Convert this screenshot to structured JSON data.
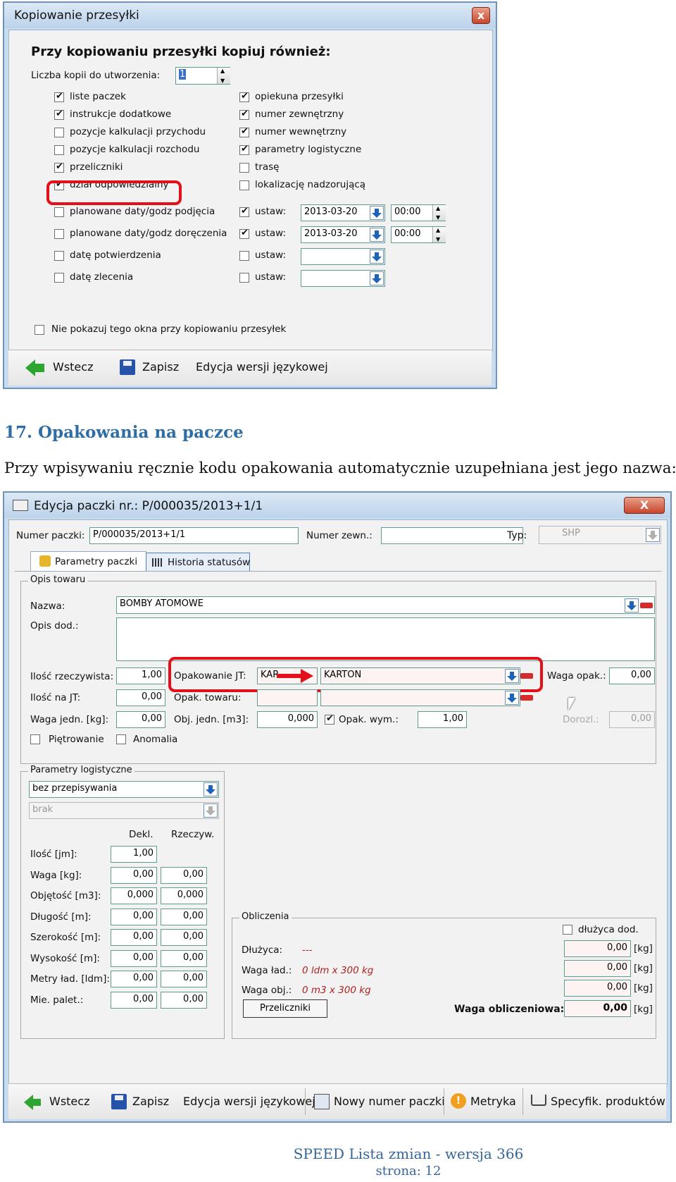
{
  "dialog1": {
    "title": "Kopiowanie przesyłki",
    "close": "x",
    "heading": "Przy kopiowaniu przesyłki kopiuj również:",
    "copies_label": "Liczba kopii do utworzenia:",
    "copies_value": "1",
    "left_checks": [
      {
        "label": "liste paczek",
        "checked": true
      },
      {
        "label": "instrukcje dodatkowe",
        "checked": true
      },
      {
        "label": "pozycje kalkulacji przychodu",
        "checked": false
      },
      {
        "label": "pozycje kalkulacji rozchodu",
        "checked": false
      },
      {
        "label": "przeliczniki",
        "checked": true
      },
      {
        "label": "dział odpowiedzialny",
        "checked": true
      }
    ],
    "right_checks": [
      {
        "label": "opiekuna przesyłki",
        "checked": true
      },
      {
        "label": "numer zewnętrzny",
        "checked": true
      },
      {
        "label": "numer wewnętrzny",
        "checked": true
      },
      {
        "label": "parametry logistyczne",
        "checked": true
      },
      {
        "label": "trasę",
        "checked": false
      },
      {
        "label": "lokalizację nadzorującą",
        "checked": false
      }
    ],
    "date_rows": [
      {
        "label": "planowane daty/godz podjęcia",
        "set_label": "ustaw:",
        "set_checked": true,
        "date": "2013-03-20",
        "time": "00:00"
      },
      {
        "label": "planowane daty/godz doręczenia",
        "set_label": "ustaw:",
        "set_checked": true,
        "date": "2013-03-20",
        "time": "00:00"
      },
      {
        "label": "datę potwierdzenia",
        "set_label": "ustaw:",
        "set_checked": false,
        "date": "",
        "time": ""
      },
      {
        "label": "datę zlecenia",
        "set_label": "ustaw:",
        "set_checked": false,
        "date": "",
        "time": ""
      }
    ],
    "dont_show": "Nie pokazuj tego okna przy kopiowaniu przesyłek",
    "buttons": {
      "back": "Wstecz",
      "save": "Zapisz",
      "lang": "Edycja wersji językowej"
    }
  },
  "section": {
    "heading": "17. Opakowania na paczce",
    "paragraph": "Przy wpisywaniu ręcznie kodu opakowania automatycznie uzupełniana jest jego nazwa:"
  },
  "dialog2": {
    "title": "Edycja paczki nr.: P/000035/2013+1/1",
    "close": "X",
    "numer_paczki_label": "Numer paczki:",
    "numer_paczki_value": "P/000035/2013+1/1",
    "numer_zewn_label": "Numer zewn.:",
    "numer_zewn_value": "",
    "typ_label": "Typ:",
    "typ_value": "SHP",
    "tabs": [
      "Parametry paczki",
      "Historia statusów"
    ],
    "opis_group": "Opis towaru",
    "nazwa_label": "Nazwa:",
    "nazwa_value": "BOMBY ATOMOWE",
    "opis_dod_label": "Opis dod.:",
    "ilosc_rzecz_label": "Ilość rzeczywista:",
    "ilosc_rzecz_value": "1,00",
    "opak_jt_label": "Opakowanie JT:",
    "opak_jt_code": "KAR",
    "opak_jt_name": "KARTON",
    "waga_opak_label": "Waga opak.:",
    "waga_opak_value": "0,00",
    "ilosc_jt_label": "Ilość na JT:",
    "ilosc_jt_value": "0,00",
    "opak_towaru_label": "Opak. towaru:",
    "waga_jedn_label": "Waga jedn. [kg]:",
    "waga_jedn_value": "0,00",
    "obj_jedn_label": "Obj. jedn. [m3]:",
    "obj_jedn_value": "0,000",
    "opak_wym_label": "Opak. wym.:",
    "opak_wym_value": "1,00",
    "dozrol_label": "Dorozl.:",
    "dozrol_value": "0,00",
    "pietrowanie": "Piętrowanie",
    "anomalia": "Anomalia",
    "logist_group": "Parametry logistyczne",
    "logist_select1": "bez przepisywania",
    "logist_select2": "brak",
    "col_dekl": "Dekl.",
    "col_rzecz": "Rzeczyw.",
    "rows": [
      {
        "label": "Ilość [jm]:",
        "dekl": "1,00",
        "rzecz": null
      },
      {
        "label": "Waga [kg]:",
        "dekl": "0,00",
        "rzecz": "0,00"
      },
      {
        "label": "Objętość [m3]:",
        "dekl": "0,000",
        "rzecz": "0,000"
      },
      {
        "label": "Długość [m]:",
        "dekl": "0,00",
        "rzecz": "0,00"
      },
      {
        "label": "Szerokość [m]:",
        "dekl": "0,00",
        "rzecz": "0,00"
      },
      {
        "label": "Wysokość [m]:",
        "dekl": "0,00",
        "rzecz": "0,00"
      },
      {
        "label": "Metry ład. [ldm]:",
        "dekl": "0,00",
        "rzecz": "0,00"
      },
      {
        "label": "Mie. palet.:",
        "dekl": "0,00",
        "rzecz": "0,00"
      }
    ],
    "obliczenia_group": "Obliczenia",
    "dluzyca_dod": "dłużyca dod.",
    "dluzyca_label": "Dłużyca:",
    "dluzyca_value": "---",
    "waga_lad_label": "Waga ład.:",
    "waga_lad_value": "0 ldm x 300 kg",
    "waga_obj_label": "Waga obj.:",
    "waga_obj_value": "0 m3 x 300 kg",
    "calc_fields": [
      "0,00",
      "0,00",
      "0,00"
    ],
    "unit": "[kg]",
    "przeliczniki_btn": "Przeliczniki",
    "waga_oblicz_label": "Waga obliczeniowa:",
    "waga_oblicz_value": "0,00",
    "buttons": {
      "back": "Wstecz",
      "save": "Zapisz",
      "lang": "Edycja wersji językowej",
      "new_num": "Nowy numer paczki",
      "metryka": "Metryka",
      "spec": "Specyfik. produktów"
    }
  },
  "footer": {
    "line1": "SPEED Lista zmian - wersja 366",
    "line2": "strona: 12"
  }
}
